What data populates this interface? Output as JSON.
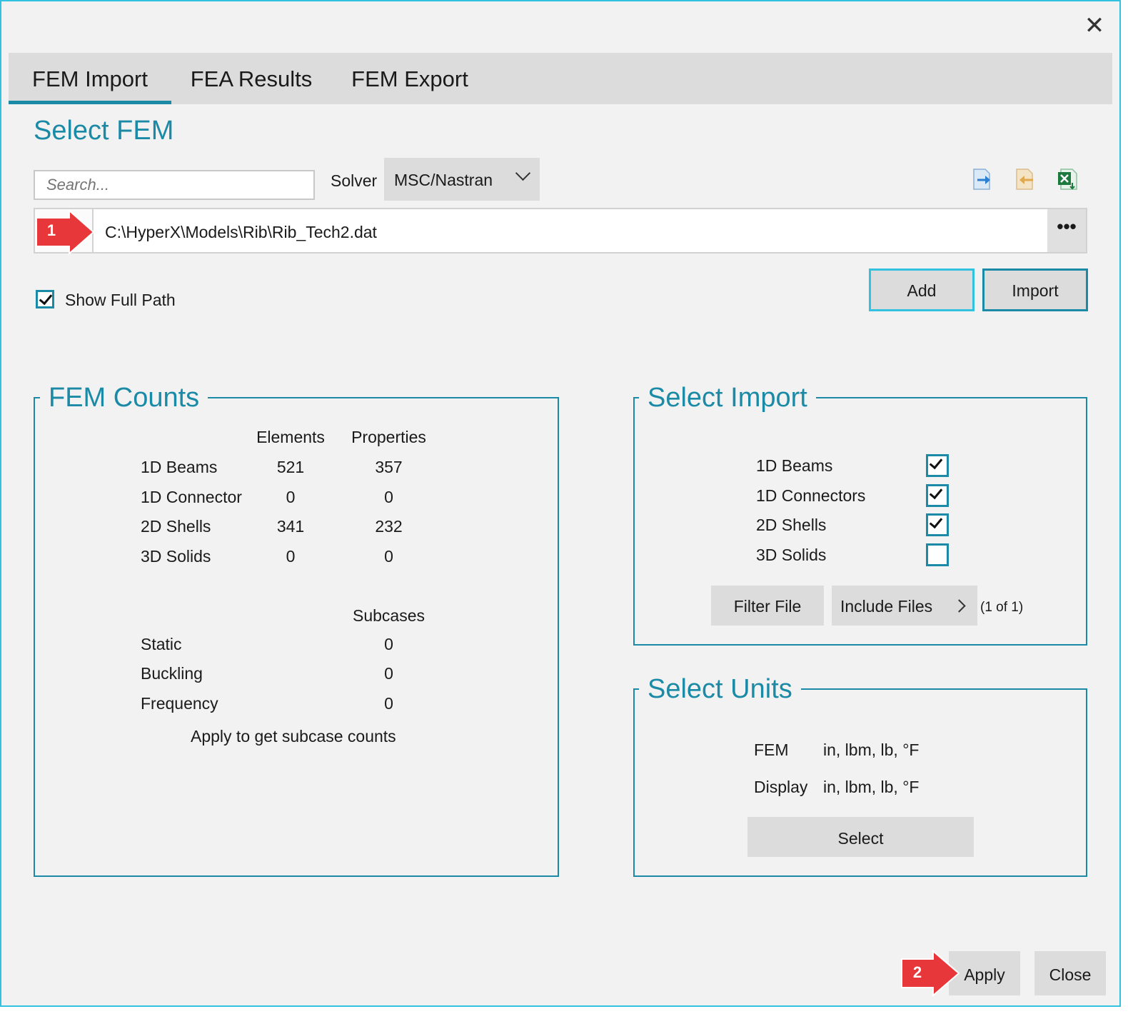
{
  "window": {
    "close_glyph": "✕"
  },
  "tabs": [
    {
      "label": "FEM Import",
      "active": true
    },
    {
      "label": "FEA Results",
      "active": false
    },
    {
      "label": "FEM Export",
      "active": false
    }
  ],
  "select_fem": {
    "title": "Select FEM",
    "search_placeholder": "Search...",
    "solver_label": "Solver",
    "solver_value": "MSC/Nastran",
    "file_path": "C:\\HyperX\\Models\\Rib\\Rib_Tech2.dat",
    "browse_label": "•••",
    "show_full_path_label": "Show Full Path",
    "show_full_path_checked": true,
    "add_label": "Add",
    "import_label": "Import",
    "toolbar_icons": [
      "export-icon",
      "import-icon",
      "excel-icon"
    ]
  },
  "fem_counts": {
    "title": "FEM Counts",
    "headers": [
      "Elements",
      "Properties"
    ],
    "rows": [
      {
        "label": "1D Beams",
        "elements": "521",
        "properties": "357"
      },
      {
        "label": "1D Connector",
        "elements": "0",
        "properties": "0"
      },
      {
        "label": "2D Shells",
        "elements": "341",
        "properties": "232"
      },
      {
        "label": "3D Solids",
        "elements": "0",
        "properties": "0"
      }
    ],
    "subcases_header": "Subcases",
    "subcases": [
      {
        "label": "Static",
        "value": "0"
      },
      {
        "label": "Buckling",
        "value": "0"
      },
      {
        "label": "Frequency",
        "value": "0"
      }
    ],
    "note": "Apply to get subcase counts"
  },
  "select_import": {
    "title": "Select Import",
    "items": [
      {
        "label": "1D Beams",
        "checked": true
      },
      {
        "label": "1D Connectors",
        "checked": true
      },
      {
        "label": "2D Shells",
        "checked": true
      },
      {
        "label": "3D Solids",
        "checked": false
      }
    ],
    "filter_file_label": "Filter File",
    "include_files_label": "Include Files",
    "include_count": "(1 of 1)"
  },
  "select_units": {
    "title": "Select Units",
    "fem_label": "FEM",
    "fem_value": "in, lbm, lb, °F",
    "display_label": "Display",
    "display_value": "in, lbm, lb, °F",
    "select_label": "Select"
  },
  "footer": {
    "apply_label": "Apply",
    "close_label": "Close"
  },
  "callouts": {
    "one": "1",
    "two": "2"
  },
  "colors": {
    "accent": "#1a8aa6",
    "focus": "#33c1e0",
    "callout": "#e8373a"
  }
}
